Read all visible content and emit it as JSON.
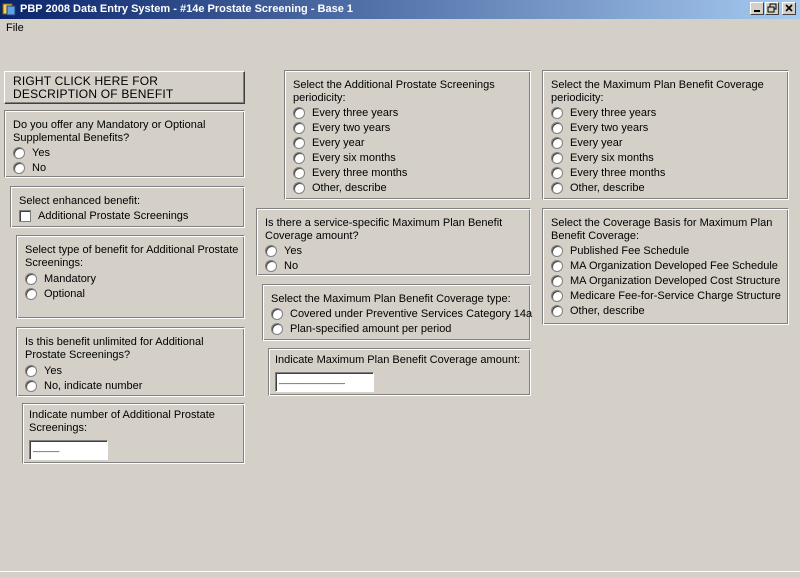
{
  "window": {
    "title": "PBP 2008 Data Entry System - #14e Prostate Screening - Base 1"
  },
  "menu": {
    "file": "File"
  },
  "description_button": "RIGHT CLICK HERE FOR DESCRIPTION OF BENEFIT",
  "mandatory_optional": {
    "question": "Do you offer any Mandatory or Optional Supplemental Benefits?",
    "options": [
      "Yes",
      "No"
    ]
  },
  "enhanced_benefit": {
    "question": "Select enhanced benefit:",
    "option": "Additional Prostate Screenings"
  },
  "benefit_type": {
    "question": "Select type of benefit for Additional Prostate Screenings:",
    "options": [
      "Mandatory",
      "Optional"
    ]
  },
  "unlimited": {
    "question": "Is this benefit unlimited for Additional Prostate Screenings?",
    "options": [
      "Yes",
      "No, indicate number"
    ]
  },
  "number_screenings": {
    "question": "Indicate number of Additional Prostate Screenings:",
    "value": "____"
  },
  "screening_periodicity": {
    "question": "Select the Additional Prostate Screenings periodicity:",
    "options": [
      "Every three years",
      "Every two years",
      "Every year",
      "Every six months",
      "Every three months",
      "Other, describe"
    ]
  },
  "service_specific_max": {
    "question": "Is there a service-specific Maximum Plan Benefit Coverage amount?",
    "options": [
      "Yes",
      "No"
    ]
  },
  "max_coverage_type": {
    "question": "Select the Maximum Plan Benefit Coverage type:",
    "options": [
      "Covered under Preventive Services Category 14a",
      "Plan-specified amount per period"
    ]
  },
  "max_coverage_amount": {
    "question": "Indicate Maximum Plan Benefit Coverage amount:",
    "value": "__________"
  },
  "max_periodicity": {
    "question": "Select the Maximum Plan Benefit Coverage periodicity:",
    "options": [
      "Every three years",
      "Every two years",
      "Every year",
      "Every six months",
      "Every three months",
      "Other, describe"
    ]
  },
  "coverage_basis": {
    "question": "Select the Coverage Basis for Maximum Plan Benefit Coverage:",
    "options": [
      "Published Fee Schedule",
      "MA Organization Developed Fee Schedule",
      "MA Organization Developed Cost Structure",
      "Medicare Fee-for-Service Charge Structure",
      "Other, describe"
    ]
  },
  "colors": {
    "face": "#d4d0c8",
    "title_start": "#0a246a",
    "title_end": "#a6caf0"
  }
}
